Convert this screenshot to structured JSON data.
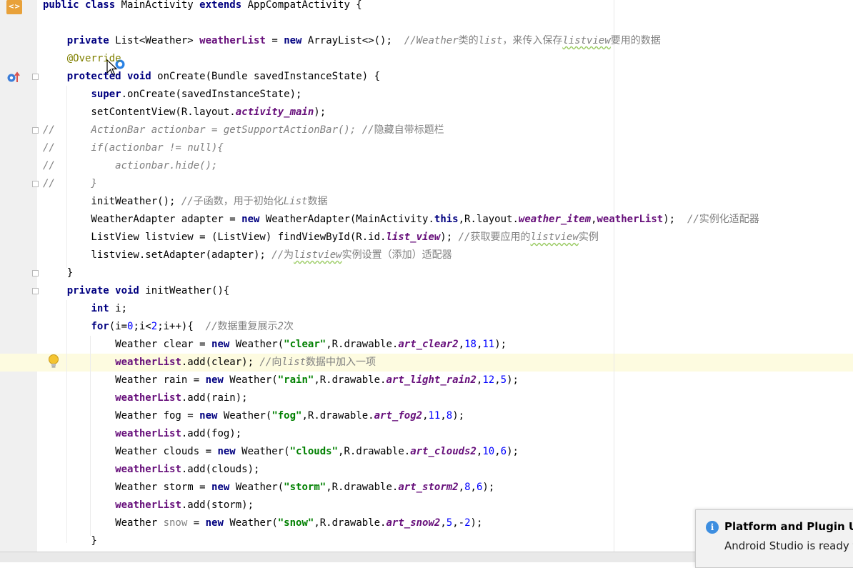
{
  "notification": {
    "title": "Platform and Plugin Upc",
    "body": "Android Studio is ready t"
  },
  "icons": {
    "file": "java-class-icon",
    "override": "override-method-icon",
    "intention": "lightbulb-icon",
    "cursor": "mouse-pointer-icon",
    "notification": "info-icon"
  },
  "colors": {
    "keyword": "#000080",
    "field": "#660e7a",
    "string": "#008000",
    "number": "#0000ff",
    "comment": "#808080",
    "annotation": "#808000",
    "caret_line": "#fdfbe0"
  },
  "code": {
    "l0": [
      {
        "t": "public class ",
        "c": "kw"
      },
      {
        "t": "MainActivity "
      },
      {
        "t": "extends ",
        "c": "kw"
      },
      {
        "t": "AppCompatActivity {"
      }
    ],
    "l1": [],
    "l2": [
      {
        "t": "    "
      },
      {
        "t": "private ",
        "c": "kw"
      },
      {
        "t": "List<Weather> "
      },
      {
        "t": "weatherList",
        "c": "fld"
      },
      {
        "t": " = "
      },
      {
        "t": "new ",
        "c": "kw"
      },
      {
        "t": "ArrayList<>();  "
      },
      {
        "t": "//Weather",
        "c": "cmt"
      },
      {
        "t": "类的",
        "c": "cmt cmtz"
      },
      {
        "t": "list",
        "c": "cmt"
      },
      {
        "t": "，来传入保存",
        "c": "cmt cmtz"
      },
      {
        "t": "listview",
        "c": "cmt typo"
      },
      {
        "t": "要用的数据",
        "c": "cmt cmtz"
      }
    ],
    "l3": [
      {
        "t": "    "
      },
      {
        "t": "@Override",
        "c": "ann"
      }
    ],
    "l4": [
      {
        "t": "    "
      },
      {
        "t": "protected void ",
        "c": "kw"
      },
      {
        "t": "onCreate(Bundle savedInstanceState) {"
      }
    ],
    "l5": [
      {
        "t": "        "
      },
      {
        "t": "super",
        "c": "kw"
      },
      {
        "t": ".onCreate(savedInstanceState);"
      }
    ],
    "l6": [
      {
        "t": "        setContentView(R.layout."
      },
      {
        "t": "activity_main",
        "c": "sfld"
      },
      {
        "t": ");"
      }
    ],
    "l7": [
      {
        "t": "//      ActionBar actionbar = getSupportActionBar(); //",
        "c": "cmt"
      },
      {
        "t": "隐藏自带标题栏",
        "c": "cmt cmtz"
      }
    ],
    "l8": [
      {
        "t": "//      if(actionbar != null){",
        "c": "cmt"
      }
    ],
    "l9": [
      {
        "t": "//          actionbar.hide();",
        "c": "cmt"
      }
    ],
    "l10": [
      {
        "t": "//      }",
        "c": "cmt"
      }
    ],
    "l11": [
      {
        "t": "        initWeather(); "
      },
      {
        "t": "//",
        "c": "cmt"
      },
      {
        "t": "子函数，用于初始化",
        "c": "cmt cmtz"
      },
      {
        "t": "List",
        "c": "cmt"
      },
      {
        "t": "数据",
        "c": "cmt cmtz"
      }
    ],
    "l12": [
      {
        "t": "        WeatherAdapter adapter = "
      },
      {
        "t": "new ",
        "c": "kw"
      },
      {
        "t": "WeatherAdapter(MainActivity."
      },
      {
        "t": "this",
        "c": "kw"
      },
      {
        "t": ",R.layout."
      },
      {
        "t": "weather_item",
        "c": "sfld"
      },
      {
        "t": ","
      },
      {
        "t": "weatherList",
        "c": "fld"
      },
      {
        "t": ");  "
      },
      {
        "t": "//",
        "c": "cmt"
      },
      {
        "t": "实例化适配器",
        "c": "cmt cmtz"
      }
    ],
    "l13": [
      {
        "t": "        ListView listview = (ListView) findViewById(R.id."
      },
      {
        "t": "list_view",
        "c": "sfld"
      },
      {
        "t": "); "
      },
      {
        "t": "//",
        "c": "cmt"
      },
      {
        "t": "获取要应用的",
        "c": "cmt cmtz"
      },
      {
        "t": "listview",
        "c": "cmt typo"
      },
      {
        "t": "实例",
        "c": "cmt cmtz"
      }
    ],
    "l14": [
      {
        "t": "        listview.setAdapter(adapter); "
      },
      {
        "t": "//",
        "c": "cmt"
      },
      {
        "t": "为",
        "c": "cmt cmtz"
      },
      {
        "t": "listview",
        "c": "cmt typo"
      },
      {
        "t": "实例设置（添加）适配器",
        "c": "cmt cmtz"
      }
    ],
    "l15": [
      {
        "t": "    }"
      }
    ],
    "l16": [
      {
        "t": "    "
      },
      {
        "t": "private void ",
        "c": "kw"
      },
      {
        "t": "initWeather(){"
      }
    ],
    "l17": [
      {
        "t": "        "
      },
      {
        "t": "int ",
        "c": "kw"
      },
      {
        "t": "i;"
      }
    ],
    "l18": [
      {
        "t": "        "
      },
      {
        "t": "for",
        "c": "kw"
      },
      {
        "t": "(i="
      },
      {
        "t": "0",
        "c": "num"
      },
      {
        "t": ";i<"
      },
      {
        "t": "2",
        "c": "num"
      },
      {
        "t": ";i++){  "
      },
      {
        "t": "//",
        "c": "cmt"
      },
      {
        "t": "数据重复展示",
        "c": "cmt cmtz"
      },
      {
        "t": "2",
        "c": "cmt"
      },
      {
        "t": "次",
        "c": "cmt cmtz"
      }
    ],
    "l19": [
      {
        "t": "            Weather clear = "
      },
      {
        "t": "new ",
        "c": "kw"
      },
      {
        "t": "Weather("
      },
      {
        "t": "\"clear\"",
        "c": "str"
      },
      {
        "t": ",R.drawable."
      },
      {
        "t": "art_clear2",
        "c": "sfld"
      },
      {
        "t": ","
      },
      {
        "t": "18",
        "c": "num"
      },
      {
        "t": ","
      },
      {
        "t": "11",
        "c": "num"
      },
      {
        "t": ");"
      }
    ],
    "l20": [
      {
        "t": "            "
      },
      {
        "t": "weatherList",
        "c": "fld"
      },
      {
        "t": ".add(clear); "
      },
      {
        "t": "//",
        "c": "cmt"
      },
      {
        "t": "向",
        "c": "cmt cmtz"
      },
      {
        "t": "list",
        "c": "cmt"
      },
      {
        "t": "数据中加入一项",
        "c": "cmt cmtz"
      }
    ],
    "l21": [
      {
        "t": "            Weather rain = "
      },
      {
        "t": "new ",
        "c": "kw"
      },
      {
        "t": "Weather("
      },
      {
        "t": "\"rain\"",
        "c": "str"
      },
      {
        "t": ",R.drawable."
      },
      {
        "t": "art_light_rain2",
        "c": "sfld"
      },
      {
        "t": ","
      },
      {
        "t": "12",
        "c": "num"
      },
      {
        "t": ","
      },
      {
        "t": "5",
        "c": "num"
      },
      {
        "t": ");"
      }
    ],
    "l22": [
      {
        "t": "            "
      },
      {
        "t": "weatherList",
        "c": "fld"
      },
      {
        "t": ".add(rain);"
      }
    ],
    "l23": [
      {
        "t": "            Weather fog = "
      },
      {
        "t": "new ",
        "c": "kw"
      },
      {
        "t": "Weather("
      },
      {
        "t": "\"fog\"",
        "c": "str"
      },
      {
        "t": ",R.drawable."
      },
      {
        "t": "art_fog2",
        "c": "sfld"
      },
      {
        "t": ","
      },
      {
        "t": "11",
        "c": "num"
      },
      {
        "t": ","
      },
      {
        "t": "8",
        "c": "num"
      },
      {
        "t": ");"
      }
    ],
    "l24": [
      {
        "t": "            "
      },
      {
        "t": "weatherList",
        "c": "fld"
      },
      {
        "t": ".add(fog);"
      }
    ],
    "l25": [
      {
        "t": "            Weather clouds = "
      },
      {
        "t": "new ",
        "c": "kw"
      },
      {
        "t": "Weather("
      },
      {
        "t": "\"clouds\"",
        "c": "str"
      },
      {
        "t": ",R.drawable."
      },
      {
        "t": "art_clouds2",
        "c": "sfld"
      },
      {
        "t": ","
      },
      {
        "t": "10",
        "c": "num"
      },
      {
        "t": ","
      },
      {
        "t": "6",
        "c": "num"
      },
      {
        "t": ");"
      }
    ],
    "l26": [
      {
        "t": "            "
      },
      {
        "t": "weatherList",
        "c": "fld"
      },
      {
        "t": ".add(clouds);"
      }
    ],
    "l27": [
      {
        "t": "            Weather storm = "
      },
      {
        "t": "new ",
        "c": "kw"
      },
      {
        "t": "Weather("
      },
      {
        "t": "\"storm\"",
        "c": "str"
      },
      {
        "t": ",R.drawable."
      },
      {
        "t": "art_storm2",
        "c": "sfld"
      },
      {
        "t": ","
      },
      {
        "t": "8",
        "c": "num"
      },
      {
        "t": ","
      },
      {
        "t": "6",
        "c": "num"
      },
      {
        "t": ");"
      }
    ],
    "l28": [
      {
        "t": "            "
      },
      {
        "t": "weatherList",
        "c": "fld"
      },
      {
        "t": ".add(storm);"
      }
    ],
    "l29": [
      {
        "t": "            Weather "
      },
      {
        "t": "snow",
        "c": "unused"
      },
      {
        "t": " = "
      },
      {
        "t": "new ",
        "c": "kw"
      },
      {
        "t": "Weather("
      },
      {
        "t": "\"snow\"",
        "c": "str"
      },
      {
        "t": ",R.drawable."
      },
      {
        "t": "art_snow2",
        "c": "sfld"
      },
      {
        "t": ","
      },
      {
        "t": "5",
        "c": "num"
      },
      {
        "t": ",-"
      },
      {
        "t": "2",
        "c": "num"
      },
      {
        "t": ");"
      }
    ],
    "l30": [
      {
        "t": "        }"
      }
    ]
  }
}
